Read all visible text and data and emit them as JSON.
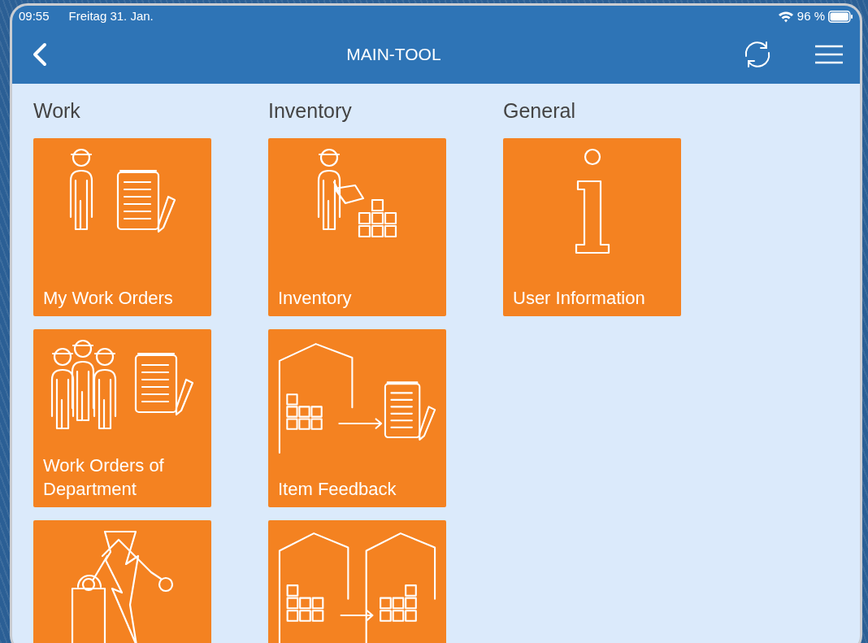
{
  "status_bar": {
    "time": "09:55",
    "date": "Freitag 31. Jan.",
    "battery": "96 %"
  },
  "header": {
    "title": "MAIN-TOOL"
  },
  "sections": [
    {
      "title": "Work",
      "tiles": [
        {
          "kind": "worker-orders",
          "label": "My Work Orders"
        },
        {
          "kind": "team-orders",
          "label": "Work Orders of Department"
        },
        {
          "kind": "robot-fault"
        }
      ]
    },
    {
      "title": "Inventory",
      "tiles": [
        {
          "kind": "inventory",
          "label": "Inventory"
        },
        {
          "kind": "item-feedback",
          "label": "Item Feedback"
        },
        {
          "kind": "transfer"
        }
      ]
    },
    {
      "title": "General",
      "tiles": [
        {
          "kind": "info",
          "label": "User Information"
        }
      ]
    }
  ]
}
